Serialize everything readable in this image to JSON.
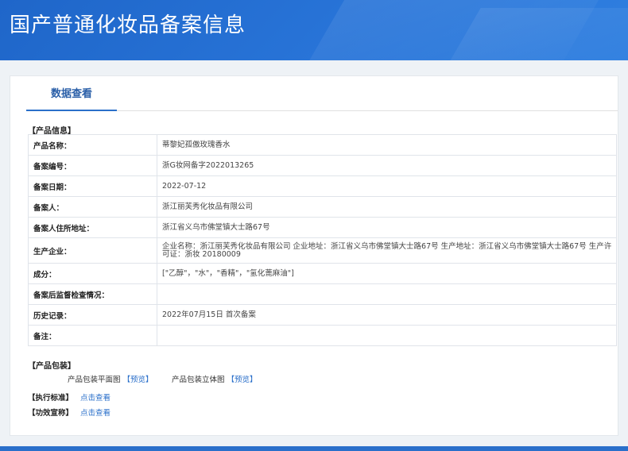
{
  "header": {
    "title": "国产普通化妆品备案信息"
  },
  "tabs": [
    {
      "label": "数据查看"
    }
  ],
  "product_section": {
    "title": "【产品信息】"
  },
  "info_rows": [
    {
      "label": "产品名称：",
      "value": "蒂黎妃孤傲玫瑰香水"
    },
    {
      "label": "备案编号：",
      "value": "浙G妆网备字2022013265"
    },
    {
      "label": "备案日期：",
      "value": "2022-07-12"
    },
    {
      "label": "备案人：",
      "value": "浙江丽芙秀化妆品有限公司"
    },
    {
      "label": "备案人住所地址：",
      "value": "浙江省义乌市佛堂镇大士路67号"
    },
    {
      "label": "生产企业：",
      "value": "企业名称：浙江丽芙秀化妆品有限公司 企业地址：浙江省义乌市佛堂镇大士路67号 生产地址：浙江省义乌市佛堂镇大士路67号 生产许可证：浙妆 20180009"
    },
    {
      "label": "成分：",
      "value": "[\"乙醇\"，\"水\"，\"香精\"，\"氢化蓖麻油\"]"
    },
    {
      "label": "备案后监督检查情况：",
      "value": ""
    },
    {
      "label": "历史记录：",
      "value": "2022年07月15日 首次备案"
    },
    {
      "label": "备注：",
      "value": ""
    }
  ],
  "packaging": {
    "title": "【产品包装】",
    "flat_label": "产品包装平面图",
    "flat_link": "【预览】",
    "three_d_label": "产品包装立体图",
    "three_d_link": "【预览】"
  },
  "standard": {
    "label": "【执行标准】",
    "link": "点击查看"
  },
  "efficacy": {
    "label": "【功效宣称】",
    "link": "点击查看"
  },
  "colors": {
    "banner": "#2874d8",
    "accent": "#2a6fca",
    "link": "#2a6fca"
  }
}
